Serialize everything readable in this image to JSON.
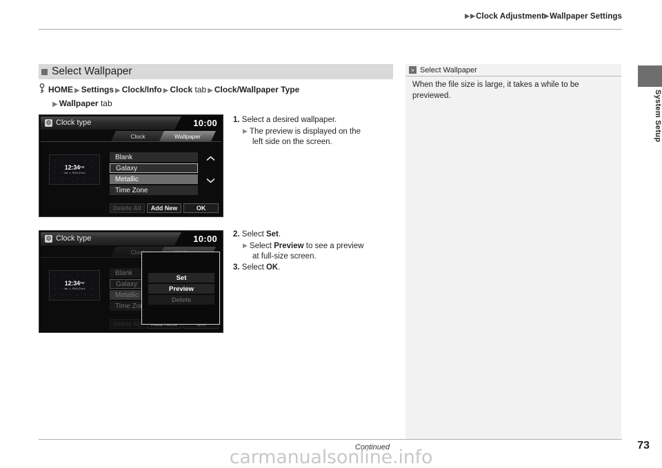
{
  "header": {
    "breadcrumb": [
      {
        "arrow": "▶",
        "label": ""
      },
      {
        "arrow": "▶",
        "label": "Clock Adjustment"
      },
      {
        "arrow": "▶",
        "label": "Wallpaper Settings"
      }
    ],
    "crumb1": "Clock Adjustment",
    "crumb2": "Wallpaper Settings"
  },
  "side_tab": {
    "label": "System Setup"
  },
  "section": {
    "title": "Select Wallpaper",
    "bullet_icon": "square-marker-icon"
  },
  "nav_path": {
    "icon": "steering-key-icon",
    "line1": [
      {
        "text": "HOME",
        "bold": true
      },
      {
        "text": "Settings",
        "bold": true
      },
      {
        "text": "Clock/Info",
        "bold": true
      },
      {
        "text": "Clock",
        "bold": true,
        "suffix": " tab"
      },
      {
        "text": "Clock/Wallpaper Type",
        "bold": true
      }
    ],
    "home": "HOME",
    "settings": "Settings",
    "clock_info": "Clock/Info",
    "clock": "Clock",
    "tab_word": "tab",
    "clock_wallpaper_type": "Clock/Wallpaper Type",
    "wallpaper": "Wallpaper",
    "arrow": "▶"
  },
  "screenshot1": {
    "name": "clock-type-wallpaper-list-screen",
    "gear_icon": "gear-icon",
    "title": "Clock type",
    "clock": "10:00",
    "tabs": [
      {
        "label": "Clock",
        "active": false
      },
      {
        "label": "Wallpaper",
        "active": true
      }
    ],
    "tab_clock": "Clock",
    "tab_wallpaper": "Wallpaper",
    "preview": {
      "time": "12:34",
      "time_suffix": "PM",
      "date": "Jan. 1, 2015 (Tue.)"
    },
    "list": [
      {
        "label": "Blank",
        "state": "normal"
      },
      {
        "label": "Galaxy",
        "state": "selected"
      },
      {
        "label": "Metallic",
        "state": "highlight"
      },
      {
        "label": "Time Zone",
        "state": "normal"
      }
    ],
    "item_blank": "Blank",
    "item_galaxy": "Galaxy",
    "item_metallic": "Metallic",
    "item_timezone": "Time Zone",
    "scroll_up_icon": "chevron-up-icon",
    "scroll_down_icon": "chevron-down-icon",
    "scroll_up": "˄",
    "scroll_down": "˅",
    "buttons": [
      {
        "label": "Delete All",
        "disabled": true
      },
      {
        "label": "Add New",
        "disabled": false
      },
      {
        "label": "OK",
        "disabled": false
      }
    ],
    "btn_delete_all": "Delete All",
    "btn_add_new": "Add New",
    "btn_ok": "OK"
  },
  "screenshot2": {
    "name": "clock-type-wallpaper-popup-screen",
    "gear_icon": "gear-icon",
    "title": "Clock type",
    "clock": "10:00",
    "tab_clock": "Clock",
    "tab_wallpaper": "Wallpaper",
    "preview": {
      "time": "12:34",
      "time_suffix": "PM",
      "date": "Jan. 1, 2015 (Tue.)"
    },
    "item_blank": "Blank",
    "item_galaxy": "Galaxy",
    "item_metallic": "Metallic",
    "item_timezone": "Time Zone",
    "btn_delete_all": "Delete All",
    "btn_add_new": "Add New",
    "btn_ok": "OK",
    "popup": {
      "buttons": [
        {
          "label": "Set",
          "disabled": false
        },
        {
          "label": "Preview",
          "disabled": false
        },
        {
          "label": "Delete",
          "disabled": true
        }
      ],
      "set": "Set",
      "preview": "Preview",
      "delete": "Delete"
    }
  },
  "steps": {
    "step1": {
      "num": "1.",
      "text": "Select a desired wallpaper.",
      "sub_arrow": "▶",
      "sub_line1": "The preview is displayed on the",
      "sub_line2": "left side on the screen."
    },
    "step2": {
      "num": "2.",
      "lead": "Select ",
      "bold": "Set",
      "tail": ".",
      "sub_arrow": "▶",
      "sub_pre": "Select ",
      "sub_bold": "Preview",
      "sub_post": " to see a preview",
      "sub_line2": "at full-size screen."
    },
    "step3": {
      "num": "3.",
      "lead": "Select ",
      "bold": "OK",
      "tail": "."
    }
  },
  "sidebar": {
    "icon": "double-chevron-icon",
    "icon_glyph": "»",
    "title": "Select Wallpaper",
    "body": "When the file size is large, it takes a while to be previewed."
  },
  "footer": {
    "continued": "Continued",
    "page_number": "73",
    "watermark": "carmanualsonline.info"
  },
  "colors": {
    "section_header_bg": "#d9d9d9",
    "marker": "#6e6e6e",
    "sidebar_bg": "#f2f2f2",
    "text": "#231f20",
    "watermark": "#c8c8c8"
  }
}
